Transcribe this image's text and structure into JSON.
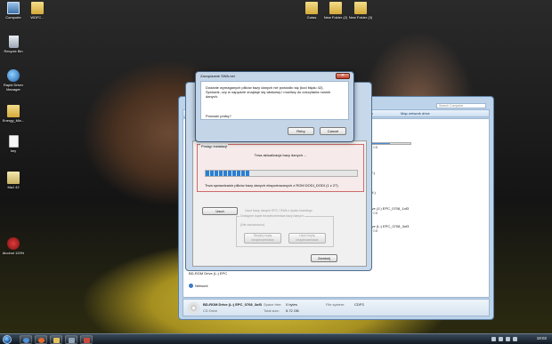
{
  "desktop": {
    "icons": [
      {
        "label": "Computer"
      },
      {
        "label": "WDFC..."
      },
      {
        "label": "Recycle Bin"
      },
      {
        "label": "Rapid Driver Manager"
      },
      {
        "label": "Energy_Mix..."
      },
      {
        "label": "key"
      },
      {
        "label": "MaJ 42"
      },
      {
        "label": "Alcohol 120%"
      },
      {
        "label": "Gotas"
      },
      {
        "label": "New Folder (2)"
      },
      {
        "label": "New Folder (3)"
      }
    ]
  },
  "popup": {
    "title": "Zarządzanie SWA.net",
    "close_glyph": "✕",
    "message": "Dodanie wymaganych plików bazy danych nie powiodło się (kod błędu 42). Sprawdź, czy w napędzie znajduje się właściwy i możliwy do odczytania nośnik danych.",
    "question": "Ponowić próbę?",
    "retry_label": "Retry",
    "cancel_label": "Cancel"
  },
  "install_dialog": {
    "title": "Zarządzanie SWA.net",
    "progress_group_title": "Postęp instalacji",
    "progress_label": "Trwa aktualizacja bazy danych ...",
    "progress_fraction": 0.29,
    "progress_status": "Trwa sprawdzanie plików bazy danych eksportowanych z ROM DODI_DODI (1 z 27)",
    "left_button": "Usuń",
    "disabled_caption": "Usuń bazę danych EPC i SWA z dysku twardego",
    "backup_group_title": "Dostępne kopie bezpieczeństwa bazy danych",
    "backup_hint": "(Nie zaznaczono)",
    "backup_left_button": "Skopiuj kopię bezpieczeństwa",
    "backup_right_button": "Usuń kopię bezpieczeństwa",
    "close_button": "Zamknij"
  },
  "explorer": {
    "toolbar": {
      "program_label": "rogram",
      "map_drive_label": "Map network drive",
      "search_placeholder": "Search Computer"
    },
    "drives": [
      {
        "label": "SY (E:)",
        "free": "e of 14.0 GB",
        "fill": 0.6
      },
      {
        "label": "al Disk (F:)",
        "free": "",
        "fill": 0
      },
      {
        "label": "al Disk (H:)",
        "free": "",
        "fill": 0
      },
      {
        "label": "ROM Drive (J:) EPC_0708_1of3",
        "free": "e of 3.52 GB",
        "fill": 0
      },
      {
        "label": "ROM Drive (L:) EPC_0708_3of3",
        "free": "e of 5.72 GB",
        "fill": 0
      }
    ],
    "nav": {
      "bd_drive": "BD-ROM Drive (L:) EPC",
      "network": "Network"
    },
    "status": {
      "name": "BD-ROM Drive (L:) EPC_0708_3of3",
      "type": "CD Drive",
      "space_free_label": "Space free:",
      "space_free": "0 bytes",
      "total_size_label": "Total size:",
      "total_size": "5.72 GB",
      "fs_label": "File system:",
      "fs": "CDFS"
    }
  },
  "taskbar": {
    "clock": "19:02"
  }
}
